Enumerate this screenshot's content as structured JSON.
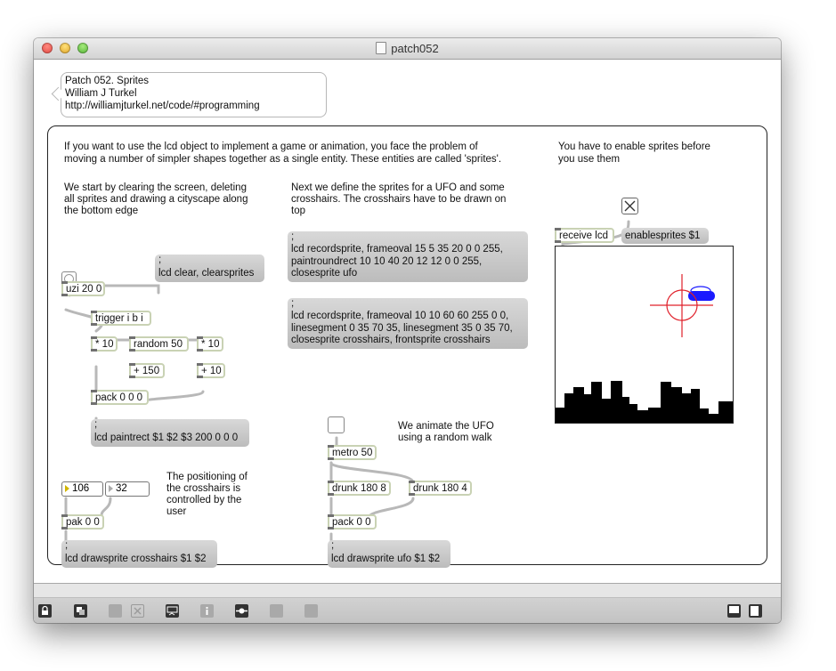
{
  "window": {
    "title": "patch052"
  },
  "comment_header": {
    "line1": "Patch 052. Sprites",
    "line2": "William J Turkel",
    "line3": "http://williamjturkel.net/code/#programming"
  },
  "intro": {
    "line1": "If you want to use the lcd object to implement a game or animation, you face the problem of",
    "line2": "moving a number of simpler shapes together as a single entity. These entities are called 'sprites'."
  },
  "enable_note": {
    "line1": "You have to enable sprites before",
    "line2": "you use them"
  },
  "clear_note": {
    "line1": "We start by clearing the screen, deleting",
    "line2": "all sprites and drawing a cityscape along",
    "line3": "the bottom edge"
  },
  "define_note": {
    "line1": "Next we define the sprites for a UFO and some",
    "line2": "crosshairs. The crosshairs have to be drawn on",
    "line3": "top"
  },
  "animate_note": {
    "line1": "We animate the UFO",
    "line2": "using a random walk"
  },
  "position_note": {
    "line1": "The positioning of",
    "line2": "the crosshairs is",
    "line3": "controlled by the",
    "line4": "user"
  },
  "objects": {
    "uzi": "uzi 20 0",
    "trigger": "trigger i b i",
    "mult10a": "* 10",
    "random": "random 50",
    "mult10b": "* 10",
    "plus150": "+ 150",
    "plus10": "+ 10",
    "pack3": "pack 0 0 0",
    "receive": "receive lcd",
    "metro": "metro 50",
    "drunk1": "drunk 180 8",
    "drunk2": "drunk 180 4",
    "pack2": "pack 0 0",
    "pak": "pak 0 0"
  },
  "messages": {
    "clear_semicolon": ";",
    "clear": "lcd clear, clearsprites",
    "paint_semicolon": ";",
    "paint": "lcd paintrect $1 $2 $3 200 0 0 0",
    "ufo_semicolon": ";",
    "ufo1": "lcd recordsprite, frameoval 15 5 35 20 0 0 255,",
    "ufo2": "paintroundrect 10 10 40 20 12 12 0 0 255,",
    "ufo3": "closesprite ufo",
    "cross_semicolon": ";",
    "cross1": "lcd recordsprite, frameoval 10 10 60 60 255 0 0,",
    "cross2": "linesegment 0 35 70 35, linesegment 35 0 35 70,",
    "cross3": "closesprite crosshairs, frontsprite crosshairs",
    "enable": "enablesprites $1",
    "drawcross_semicolon": ";",
    "drawcross": "lcd drawsprite crosshairs $1 $2",
    "drawufo_semicolon": ";",
    "drawufo": "lcd drawsprite ufo $1 $2"
  },
  "numbers": {
    "x": "106",
    "y": "32"
  },
  "colors": {
    "ufo": "#1a1aff",
    "crosshair": "#e0202a",
    "city": "#000000",
    "outline": "#c9d2b4"
  },
  "toolbar_icons": [
    "lock-icon",
    "presentation-icon",
    "patcher-icon",
    "close-icon",
    "inspector-icon",
    "info-icon",
    "object-icon",
    "grid-icon",
    "snapshot-icon",
    "split-icon",
    "sidebar-icon"
  ]
}
